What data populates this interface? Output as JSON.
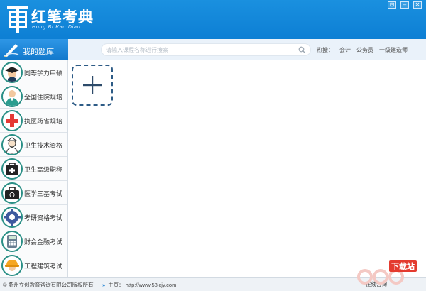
{
  "app": {
    "title": "红笔考典",
    "subtitle": "Hong Bi Kao Dian"
  },
  "window_buttons": [
    "⊡",
    "–",
    "✕"
  ],
  "nav": {
    "my_bank": "我的题库",
    "search_placeholder": "请输入课程名称进行搜索",
    "hot_label": "热搜：",
    "hot_items": [
      "会计",
      "公务员",
      "一级建造师"
    ]
  },
  "sidebar": {
    "items": [
      {
        "label": "同等学力申硕",
        "icon": "graduation-cap-icon"
      },
      {
        "label": "全国住院规培",
        "icon": "doctor-icon"
      },
      {
        "label": "执医药省规培",
        "icon": "red-cross-icon"
      },
      {
        "label": "卫生技术资格",
        "icon": "nurse-icon"
      },
      {
        "label": "卫生高级职称",
        "icon": "medical-kit-icon"
      },
      {
        "label": "医学三基考试",
        "icon": "medical-bag-icon"
      },
      {
        "label": "考研资格考试",
        "icon": "gear-icon"
      },
      {
        "label": "财会金融考试",
        "icon": "calculator-icon"
      },
      {
        "label": "工程建筑考试",
        "icon": "hard-hat-icon"
      }
    ]
  },
  "content": {
    "add_icon": "plus-icon"
  },
  "status": {
    "copyright": "© 衢州立创教育咨询有限公司版权所有",
    "homepage_label": "主页：",
    "homepage_url": "http://www.58lcjy.com",
    "online_consult": "在线咨询"
  },
  "watermark": {
    "text": "下载站"
  },
  "colors": {
    "titlebar": "#0d7fd4",
    "accent_teal": "#2a8f86",
    "add_border": "#2d5b86"
  }
}
